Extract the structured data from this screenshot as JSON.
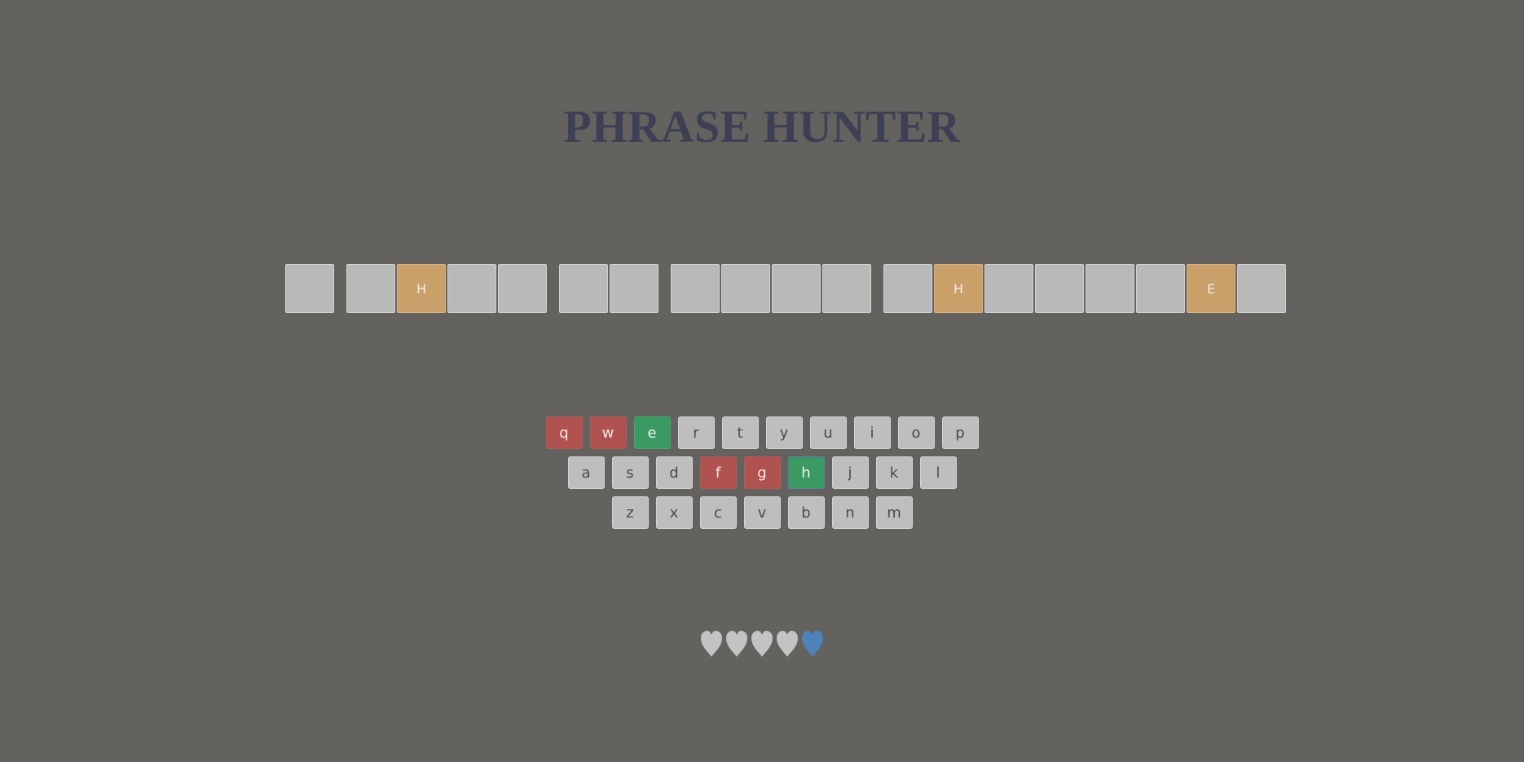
{
  "title": "PHRASE HUNTER",
  "phrase": {
    "words": [
      [
        ""
      ],
      [
        "",
        "H",
        "",
        ""
      ],
      [
        "",
        ""
      ],
      [
        "",
        "",
        "",
        ""
      ],
      [
        "",
        "H",
        "",
        "",
        "",
        "",
        "E",
        ""
      ]
    ]
  },
  "keyboard": {
    "rows": [
      [
        {
          "label": "q",
          "state": "wrong"
        },
        {
          "label": "w",
          "state": "wrong"
        },
        {
          "label": "e",
          "state": "chosen"
        },
        {
          "label": "r",
          "state": "key"
        },
        {
          "label": "t",
          "state": "key"
        },
        {
          "label": "y",
          "state": "key"
        },
        {
          "label": "u",
          "state": "key"
        },
        {
          "label": "i",
          "state": "key"
        },
        {
          "label": "o",
          "state": "key"
        },
        {
          "label": "p",
          "state": "key"
        }
      ],
      [
        {
          "label": "a",
          "state": "key"
        },
        {
          "label": "s",
          "state": "key"
        },
        {
          "label": "d",
          "state": "key"
        },
        {
          "label": "f",
          "state": "wrong"
        },
        {
          "label": "g",
          "state": "wrong"
        },
        {
          "label": "h",
          "state": "chosen focused"
        },
        {
          "label": "j",
          "state": "key"
        },
        {
          "label": "k",
          "state": "key"
        },
        {
          "label": "l",
          "state": "key"
        }
      ],
      [
        {
          "label": "z",
          "state": "key"
        },
        {
          "label": "x",
          "state": "key"
        },
        {
          "label": "c",
          "state": "key"
        },
        {
          "label": "v",
          "state": "key"
        },
        {
          "label": "b",
          "state": "key"
        },
        {
          "label": "n",
          "state": "key"
        },
        {
          "label": "m",
          "state": "key"
        }
      ]
    ]
  },
  "lives": {
    "total": 5,
    "lost": 4,
    "lost_color": "#c3c3c3",
    "live_color": "#4f82b8"
  },
  "colors": {
    "background": "#63625e",
    "title": "#3d4055",
    "shown_tile": "#c99f6a",
    "hidden_tile": "#b9b9b9",
    "wrong_key": "#b05350",
    "chosen_key": "#3b9a62"
  }
}
